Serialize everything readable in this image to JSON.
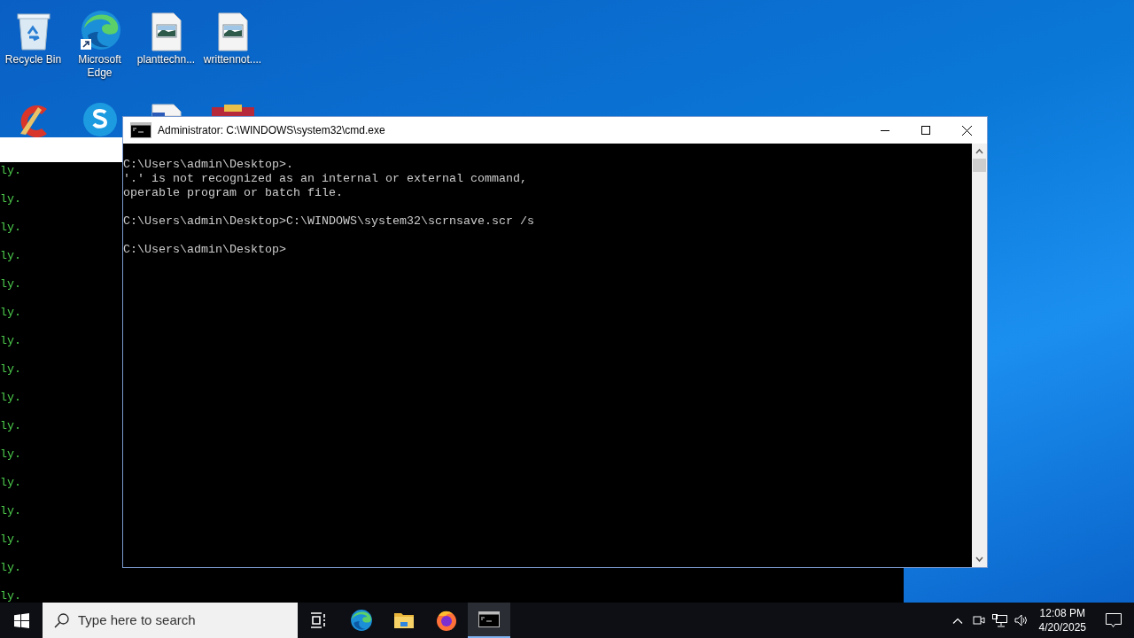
{
  "desktop_icons": [
    {
      "label": "Recycle Bin",
      "kind": "recycle"
    },
    {
      "label": "Microsoft Edge",
      "kind": "edge"
    },
    {
      "label": "planttechn...",
      "kind": "image"
    },
    {
      "label": "writtennot....",
      "kind": "image"
    }
  ],
  "background_console": {
    "lines": [
      "ly.",
      "ly.",
      "ly.",
      "ly.",
      "ly.",
      "ly.",
      "ly.",
      "ly.",
      "ly.",
      "ly.",
      "ly.",
      "ly.",
      "ly.",
      "ly.",
      "ly.",
      "ly."
    ]
  },
  "cmd_window": {
    "title": "Administrator: C:\\WINDOWS\\system32\\cmd.exe",
    "output_blocks": [
      [
        "C:\\Users\\admin\\Desktop>.",
        "'.' is not recognized as an internal or external command,",
        "operable program or batch file."
      ],
      [
        "C:\\Users\\admin\\Desktop>C:\\WINDOWS\\system32\\scrnsave.scr /s"
      ],
      [
        "C:\\Users\\admin\\Desktop>"
      ]
    ]
  },
  "taskbar": {
    "search": {
      "placeholder": "Type here to search"
    },
    "apps": [
      {
        "kind": "taskview",
        "selected": false
      },
      {
        "kind": "edge",
        "selected": false
      },
      {
        "kind": "explorer",
        "selected": false
      },
      {
        "kind": "firefox",
        "selected": false
      },
      {
        "kind": "cmd",
        "selected": true
      }
    ],
    "clock": {
      "time": "12:08 PM",
      "date": "4/20/2025"
    }
  }
}
